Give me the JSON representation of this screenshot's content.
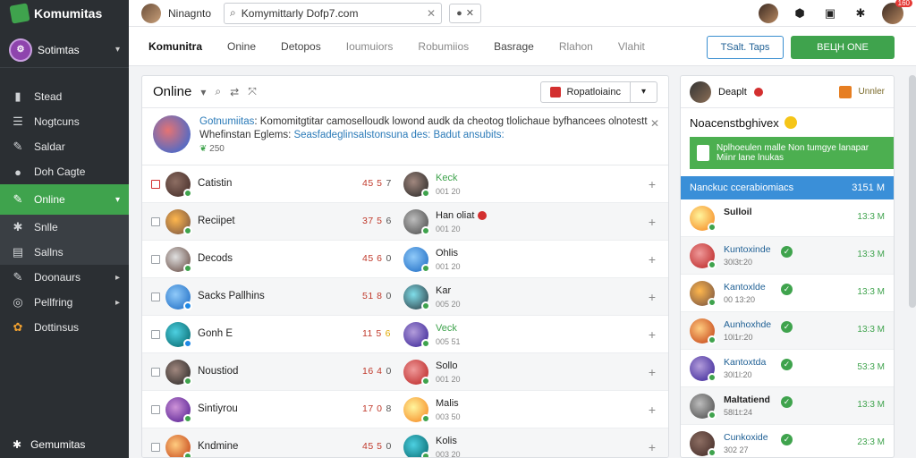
{
  "sidebar": {
    "brand": "Komumitas",
    "workspace": "Sotimtas",
    "items": [
      {
        "label": "Stead",
        "icon": "chart-bar-icon"
      },
      {
        "label": "Nogtcuns",
        "icon": "list-icon"
      },
      {
        "label": "Saldar",
        "icon": "wrench-icon"
      },
      {
        "label": "Doh Cagte",
        "icon": "people-icon"
      },
      {
        "label": "Online",
        "icon": "pencil-icon",
        "active": true
      },
      {
        "label": "Snlle",
        "icon": "gear-icon",
        "sub": true
      },
      {
        "label": "Sallns",
        "icon": "document-icon",
        "sub": true
      },
      {
        "label": "Doonaurs",
        "icon": "wrench-icon",
        "chevron": true
      },
      {
        "label": "Pellfring",
        "icon": "globe-icon",
        "chevron": true
      },
      {
        "label": "Dottinsus",
        "icon": "gift-icon"
      }
    ],
    "footer": "Gemumitas"
  },
  "topbar": {
    "user": "Ninagnto",
    "search_value": "Komymittarly Dofp7.com",
    "right_badge": "160"
  },
  "tabs": {
    "items": [
      "Komunitra",
      "Onine",
      "Detopos",
      "Ioumuiors",
      "Robumiios",
      "Basrage",
      "Rlahon",
      "Vlahit"
    ],
    "outline_button": "TSalt. Taps",
    "green_button": "ВЕЦН ONE"
  },
  "main": {
    "title": "Online",
    "report_button": "Ropatloiainc",
    "banner": {
      "line1_hl": "Gotnumiitas",
      "line1": ": Komomitgtitar camoselloudk lowond audk da cheotog tlolichaue byfhancees olnotestt",
      "line2": "Whefinstan Eglems:",
      "line2_hl": "Seasfadeglinsalstonsuna des: Badut ansubits:",
      "meta": "250"
    },
    "rows": [
      {
        "name": "Catistin",
        "sub": "",
        "v1": "45 5",
        "v2": "7",
        "name2": "Keck",
        "sub2": "001 20",
        "green2": true
      },
      {
        "name": "Reciipet",
        "sub": "",
        "v1": "37 5",
        "v2": "6",
        "name2": "Han oliat",
        "sub2": "001 20",
        "badge2": true
      },
      {
        "name": "Decods",
        "sub": "",
        "v1": "45 6",
        "v2": "0",
        "name2": "Ohlis",
        "sub2": "001 20"
      },
      {
        "name": "Sacks Pallhins",
        "sub": "",
        "v1": "51 8",
        "v2": "0",
        "name2": "Kar",
        "sub2": "005 20"
      },
      {
        "name": "Gonh E",
        "sub": "",
        "v1": "11 5",
        "v2": "6",
        "name2": "Veck",
        "sub2": "005 51",
        "green2": true,
        "yellow": true
      },
      {
        "name": "Noustiod",
        "sub": "",
        "v1": "16 4",
        "v2": "0",
        "name2": "Sollo",
        "sub2": "001 20"
      },
      {
        "name": "Sintiyrou",
        "sub": "",
        "v1": "17 0",
        "v2": "8",
        "name2": "Malis",
        "sub2": "003 50"
      },
      {
        "name": "Kndmine",
        "sub": "",
        "v1": "45 5",
        "v2": "0",
        "name2": "Kolis",
        "sub2": "003 20"
      }
    ]
  },
  "right": {
    "user": "Deaplt",
    "link": "Unnler",
    "title": "Noacenstbghivex",
    "notice_line1": "Nplhoeulen malle Non tumgye lanapar",
    "notice_line2": "Miinr lane lnukas",
    "bar_label": "Nanckuc ccerabiomiacs",
    "bar_value": "3151 M",
    "rows": [
      {
        "name": "Sulloil",
        "sub": "",
        "val": "13:3 M",
        "bold": true
      },
      {
        "name": "Kuntoxinde",
        "sub": "30l3t:20",
        "val": "13:3 M",
        "check": true
      },
      {
        "name": "Kantoxlde",
        "sub": "00 13:20",
        "val": "13:3 M",
        "check": true
      },
      {
        "name": "Aunhoxhde",
        "sub": "10l1r:20",
        "val": "13:3 M",
        "check": true
      },
      {
        "name": "Kantoxtda",
        "sub": "30l1l:20",
        "val": "53:3 M",
        "check": true
      },
      {
        "name": "Maltatiend",
        "sub": "58l1t:24",
        "val": "13:3 M",
        "check": true,
        "bold": true
      },
      {
        "name": "Cunkoxide",
        "sub": "302 27",
        "val": "23:3 M",
        "check": true
      }
    ]
  },
  "colors": {
    "accent": "#3fa34d",
    "sidebar": "#2b2f33",
    "blue": "#3a8fd8"
  }
}
